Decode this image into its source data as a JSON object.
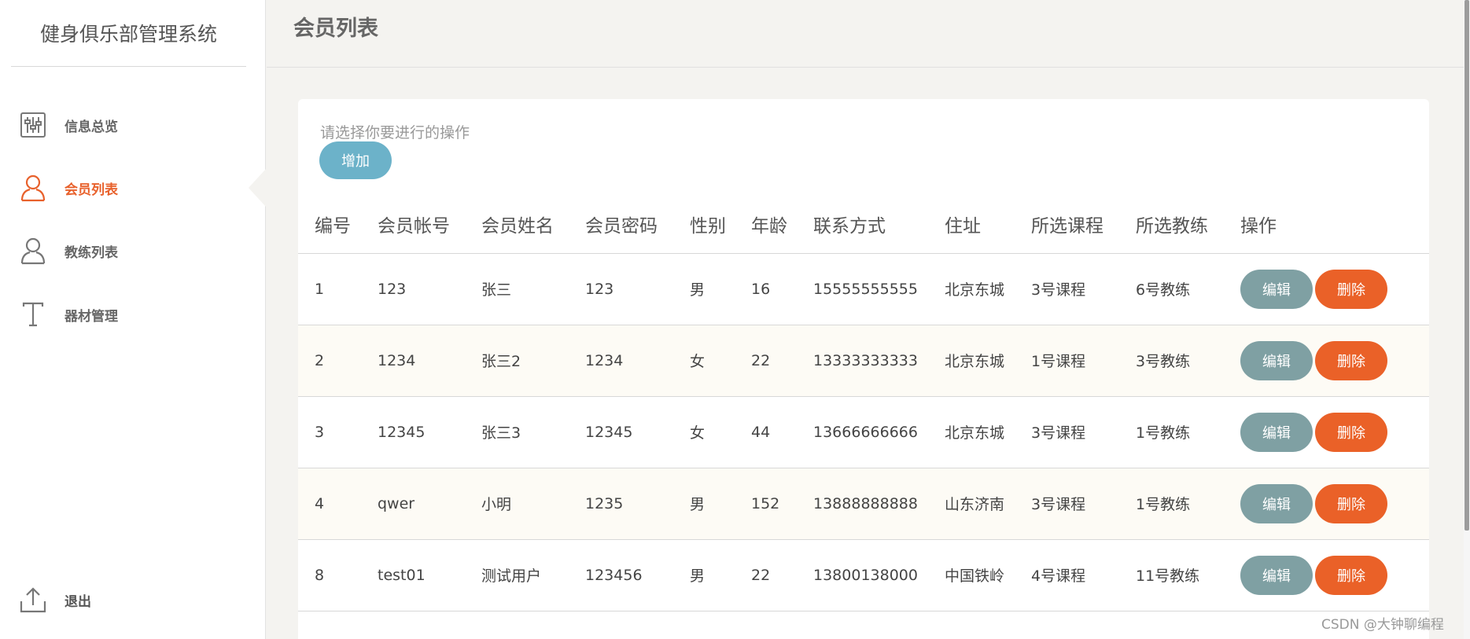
{
  "sidebar": {
    "brand": "健身俱乐部管理系统",
    "items": [
      {
        "label": "信息总览"
      },
      {
        "label": "会员列表"
      },
      {
        "label": "教练列表"
      },
      {
        "label": "器材管理"
      }
    ],
    "logout": "退出"
  },
  "header": {
    "title": "会员列表"
  },
  "main": {
    "hint": "请选择你要进行的操作",
    "add_label": "增加",
    "columns": [
      "编号",
      "会员帐号",
      "会员姓名",
      "会员密码",
      "性别",
      "年龄",
      "联系方式",
      "住址",
      "所选课程",
      "所选教练",
      "操作"
    ],
    "rows": [
      [
        "1",
        "123",
        "张三",
        "123",
        "男",
        "16",
        "15555555555",
        "北京东城",
        "3号课程",
        "6号教练"
      ],
      [
        "2",
        "1234",
        "张三2",
        "1234",
        "女",
        "22",
        "13333333333",
        "北京东城",
        "1号课程",
        "3号教练"
      ],
      [
        "3",
        "12345",
        "张三3",
        "12345",
        "女",
        "44",
        "13666666666",
        "北京东城",
        "3号课程",
        "1号教练"
      ],
      [
        "4",
        "qwer",
        "小明",
        "1235",
        "男",
        "152",
        "13888888888",
        "山东济南",
        "3号课程",
        "1号教练"
      ],
      [
        "8",
        "test01",
        "测试用户",
        "123456",
        "男",
        "22",
        "13800138000",
        "中国铁岭",
        "4号课程",
        "11号教练"
      ]
    ],
    "edit_label": "编辑",
    "delete_label": "删除"
  },
  "watermark": "CSDN @大钟聊编程",
  "colors": {
    "accent": "#e8612c",
    "add_button": "#6cb2c9",
    "edit_button": "#7fa0a3",
    "delete_button": "#ea6128"
  }
}
